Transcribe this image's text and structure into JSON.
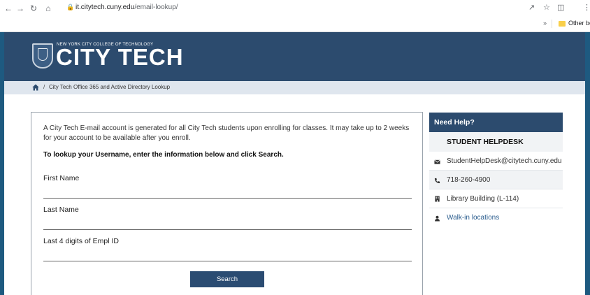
{
  "browser": {
    "url_domain": "it.citytech.cuny.edu",
    "url_path": "/email-lookup/",
    "bookmarks_chevron": "»",
    "bookmarks_folder": "Other bookmarks",
    "icons": [
      "back-icon",
      "forward-icon",
      "reload-icon",
      "home-icon",
      "lock-icon",
      "share-icon",
      "star-icon",
      "side-panel-icon",
      "menu-icon"
    ]
  },
  "header": {
    "college_line": "NEW YORK CITY COLLEGE OF TECHNOLOGY",
    "brand": "CITY TECH",
    "colors": {
      "header_bg": "#2c4b6e",
      "frame": "#1e5a80",
      "accent": "#2b4c72"
    }
  },
  "breadcrumb": {
    "separator": "/",
    "current": "City Tech Office 365 and Active Directory Lookup"
  },
  "form": {
    "intro": "A City Tech E-mail account is generated for all City Tech students upon enrolling for classes. It may take up to 2 weeks for your account to be available after you enroll.",
    "instruction": "To lookup your Username, enter the information below and click Search.",
    "fields": [
      {
        "label": "First Name",
        "value": ""
      },
      {
        "label": "Last Name",
        "value": ""
      },
      {
        "label": "Last 4 digits of Empl ID",
        "value": ""
      }
    ],
    "search_label": "Search"
  },
  "help": {
    "title": "Need Help?",
    "subtitle": "STUDENT HELPDESK",
    "items": [
      {
        "icon": "envelope-icon",
        "text": "StudentHelpDesk@citytech.cuny.edu",
        "link": false
      },
      {
        "icon": "phone-icon",
        "text": "718-260-4900",
        "link": false
      },
      {
        "icon": "building-icon",
        "text": "Library Building (L-114)",
        "link": false
      },
      {
        "icon": "person-icon",
        "text": "Walk-in locations",
        "link": true
      }
    ]
  }
}
